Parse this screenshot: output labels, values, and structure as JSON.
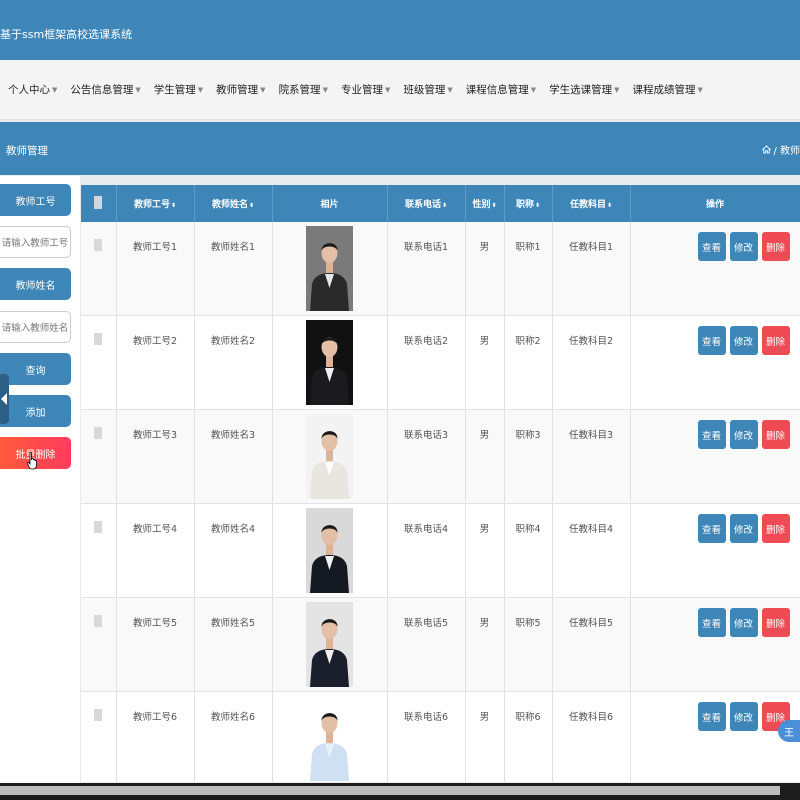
{
  "app_title": "基于ssm框架高校选课系统",
  "nav": [
    {
      "label": "个人中心"
    },
    {
      "label": "公告信息管理"
    },
    {
      "label": "学生管理"
    },
    {
      "label": "教师管理"
    },
    {
      "label": "院系管理"
    },
    {
      "label": "专业管理"
    },
    {
      "label": "班级管理"
    },
    {
      "label": "课程信息管理"
    },
    {
      "label": "学生选课管理"
    },
    {
      "label": "课程成绩管理"
    }
  ],
  "page": {
    "title": "教师管理",
    "breadcrumb": "/ 教师"
  },
  "sidebar": {
    "teacher_id_label": "教师工号",
    "teacher_id_placeholder": "请输入教师工号",
    "teacher_name_label": "教师姓名",
    "teacher_name_placeholder": "请输入教师姓名",
    "search_button": "查询",
    "add_button": "添加",
    "batch_delete_button": "批量删除"
  },
  "table": {
    "columns": [
      "教师工号",
      "教师姓名",
      "相片",
      "联系电话",
      "性别",
      "职称",
      "任教科目",
      "操作"
    ],
    "sort_glyph": "⬍",
    "actions": {
      "view": "查看",
      "edit": "修改",
      "delete": "删除"
    },
    "rows": [
      {
        "id": "教师工号1",
        "name": "教师姓名1",
        "phone": "联系电话1",
        "gender": "男",
        "title": "职称1",
        "subject": "任教科目1",
        "photo": {
          "bg": "#7a7a7a",
          "suit": "#2a2a2a",
          "shirt": "#e6e6e6"
        }
      },
      {
        "id": "教师工号2",
        "name": "教师姓名2",
        "phone": "联系电话2",
        "gender": "男",
        "title": "职称2",
        "subject": "任教科目2",
        "photo": {
          "bg": "#111111",
          "suit": "#1b1b1f",
          "shirt": "#f0f0f0"
        }
      },
      {
        "id": "教师工号3",
        "name": "教师姓名3",
        "phone": "联系电话3",
        "gender": "男",
        "title": "职称3",
        "subject": "任教科目3",
        "photo": {
          "bg": "#f3f3f3",
          "suit": "#e9e5e0",
          "shirt": "#ffffff"
        }
      },
      {
        "id": "教师工号4",
        "name": "教师姓名4",
        "phone": "联系电话4",
        "gender": "男",
        "title": "职称4",
        "subject": "任教科目4",
        "photo": {
          "bg": "#d9d9d9",
          "suit": "#151922",
          "shirt": "#f2f2f2"
        }
      },
      {
        "id": "教师工号5",
        "name": "教师姓名5",
        "phone": "联系电话5",
        "gender": "男",
        "title": "职称5",
        "subject": "任教科目5",
        "photo": {
          "bg": "#e4e4e4",
          "suit": "#1a1f2b",
          "shirt": "#f2f2f2"
        }
      },
      {
        "id": "教师工号6",
        "name": "教师姓名6",
        "phone": "联系电话6",
        "gender": "男",
        "title": "职称6",
        "subject": "任教科目6",
        "photo": {
          "bg": "#ffffff",
          "suit": "#cfe0f2",
          "shirt": "#e8f0f8"
        }
      }
    ]
  },
  "colors": {
    "primary": "#3e86b7",
    "danger": "#ee4b54",
    "batch_delete_gradient": [
      "#ff5a3a",
      "#ff3b5e"
    ]
  },
  "icons": {
    "home": "home-icon",
    "caret": "caret-down-icon",
    "collapse": "chevron-left-icon",
    "float": "translate-icon"
  },
  "float_badge_label": "王"
}
